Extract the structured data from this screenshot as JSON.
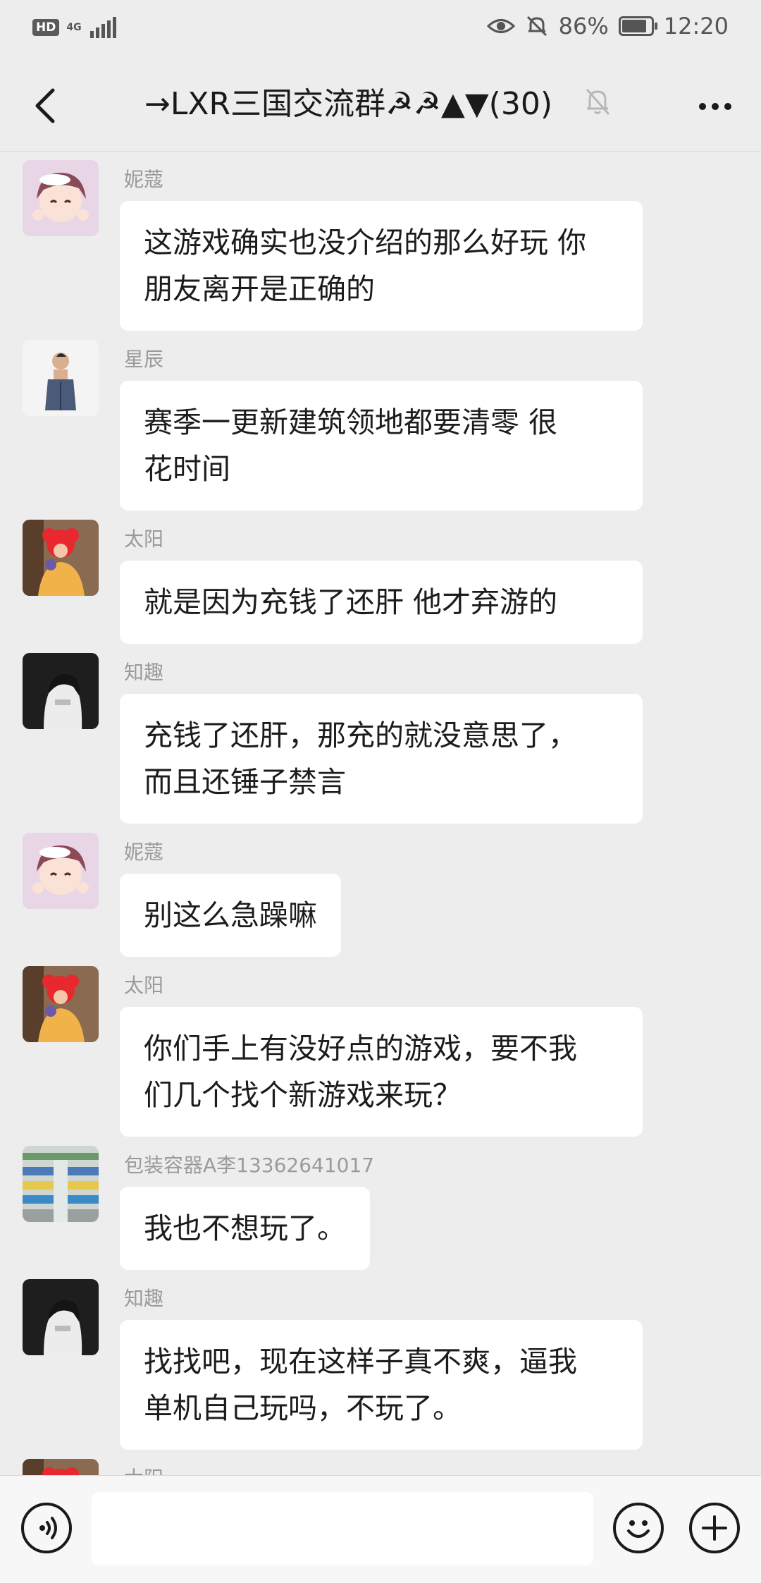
{
  "status_bar": {
    "hd": "HD",
    "network": "4G",
    "battery": "86%",
    "battery_level": 0.86,
    "time": "12:20",
    "icons": [
      "eye-icon",
      "mute-notification-icon",
      "battery-icon"
    ]
  },
  "header": {
    "title": "→LXR三国交流群☭☭▲▼(30)",
    "icons": [
      "back-arrow-icon",
      "muted-bell-icon",
      "more-dots-icon"
    ]
  },
  "messages": [
    {
      "sender": "妮蔻",
      "lines": [
        "这游戏确实也没介绍的那么好玩 你",
        "朋友离开是正确的"
      ]
    },
    {
      "sender": "星辰",
      "lines": [
        "赛季一更新建筑领地都要清零  很",
        "花时间"
      ]
    },
    {
      "sender": "太阳",
      "lines": [
        "就是因为充钱了还肝 他才弃游的"
      ]
    },
    {
      "sender": "知趣",
      "lines": [
        "充钱了还肝，那充的就没意思了，",
        "而且还锤子禁言"
      ]
    },
    {
      "sender": "妮蔻",
      "lines": [
        "别这么急躁嘛"
      ]
    },
    {
      "sender": "太阳",
      "lines": [
        "你们手上有没好点的游戏，要不我",
        "们几个找个新游戏来玩？"
      ]
    },
    {
      "sender": "包装容器A李13362641017",
      "lines": [
        "我也不想玩了。"
      ]
    },
    {
      "sender": "知趣",
      "lines": [
        "找找吧，现在这样子真不爽，逼我",
        "单机自己玩吗，不玩了。"
      ]
    },
    {
      "sender": "太阳",
      "lines": []
    }
  ],
  "input_bar": {
    "placeholder": "",
    "icons": [
      "voice-icon",
      "emoji-icon",
      "plus-icon"
    ]
  }
}
